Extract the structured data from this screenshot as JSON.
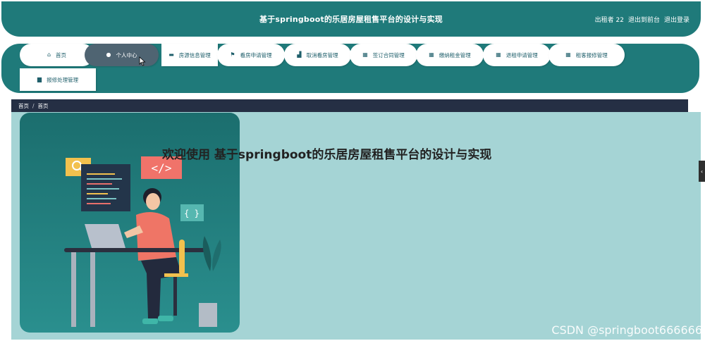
{
  "header": {
    "title": "基于springboot的乐居房屋租售平台的设计与实现",
    "user_label": "出租者 22",
    "back_label": "退出到前台",
    "logout_label": "退出登录"
  },
  "nav": {
    "items": [
      {
        "label": "首页",
        "icon": "home-icon"
      },
      {
        "label": "个人中心",
        "icon": "user-icon"
      },
      {
        "label": "房源信息管理",
        "icon": "comment-icon"
      },
      {
        "label": "看房申请管理",
        "icon": "flag-icon"
      },
      {
        "label": "取消看房管理",
        "icon": "thumb-icon"
      },
      {
        "label": "签订合同管理",
        "icon": "grid-icon"
      },
      {
        "label": "缴纳租金管理",
        "icon": "grid-icon"
      },
      {
        "label": "退租申请管理",
        "icon": "grid-icon"
      },
      {
        "label": "租客报修管理",
        "icon": "grid-icon"
      },
      {
        "label": "报修处理管理",
        "icon": "briefcase-icon"
      }
    ]
  },
  "breadcrumb": {
    "first": "首页",
    "separator": "/",
    "second": "首页"
  },
  "welcome": "欢迎使用 基于springboot的乐居房屋租售平台的设计与实现",
  "illustration": {
    "code_tag": "</>",
    "braces_tag": "{ }"
  },
  "side_tab": "‹",
  "watermark": "CSDN @springboot666666",
  "colors": {
    "primary": "#1f7a7a",
    "breadcrumb_bg": "#252f44",
    "content_bg": "#a5d4d5",
    "active_nav": "#4f6472"
  }
}
